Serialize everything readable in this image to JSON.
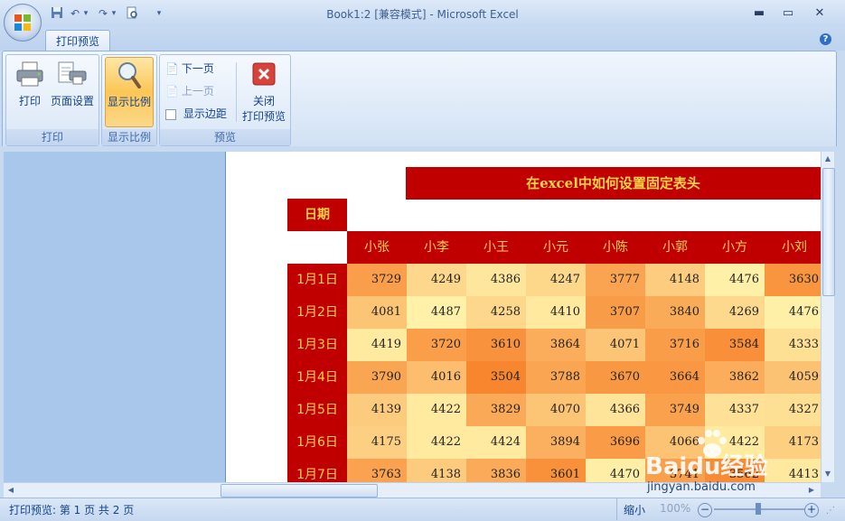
{
  "window": {
    "title": "Book1:2  [兼容模式] - Microsoft Excel",
    "minimize": "▬",
    "maximize": "▭",
    "close": "✕"
  },
  "tabs": [
    {
      "label": "打印预览",
      "active": true
    }
  ],
  "ribbon": {
    "groups": [
      {
        "label": "打印",
        "buttons": [
          {
            "label": "打印"
          },
          {
            "label": "页面设置"
          }
        ]
      },
      {
        "label": "显示比例",
        "buttons": [
          {
            "label": "显示比例",
            "active": true
          }
        ]
      },
      {
        "label": "预览",
        "small_buttons": [
          {
            "label": "下一页",
            "enabled": true
          },
          {
            "label": "上一页",
            "enabled": false
          },
          {
            "label": "显示边距",
            "checkbox": true,
            "checked": false
          }
        ],
        "close_button": {
          "line1": "关闭",
          "line2": "打印预览"
        }
      }
    ]
  },
  "sheet": {
    "title": "在excel中如何设置固定表头",
    "date_header": "日期",
    "names": [
      "小张",
      "小李",
      "小王",
      "小元",
      "小陈",
      "小郭",
      "小方",
      "小刘"
    ],
    "rows": [
      {
        "day": "1月1日",
        "values": [
          "3729",
          "4249",
          "4386",
          "4247",
          "3777",
          "4148",
          "4476",
          "3630"
        ]
      },
      {
        "day": "1月2日",
        "values": [
          "4081",
          "4487",
          "4258",
          "4410",
          "3707",
          "3840",
          "4269",
          "4476"
        ]
      },
      {
        "day": "1月3日",
        "values": [
          "4419",
          "3720",
          "3610",
          "3864",
          "4071",
          "3716",
          "3584",
          "4333"
        ]
      },
      {
        "day": "1月4日",
        "values": [
          "3790",
          "4016",
          "3504",
          "3788",
          "3670",
          "3664",
          "3862",
          "4059"
        ]
      },
      {
        "day": "1月5日",
        "values": [
          "4139",
          "4422",
          "3829",
          "4070",
          "4366",
          "3749",
          "4337",
          "4327"
        ]
      },
      {
        "day": "1月6日",
        "values": [
          "4175",
          "4422",
          "4424",
          "3894",
          "3696",
          "4066",
          "4422",
          "4173"
        ]
      },
      {
        "day": "1月7日",
        "values": [
          "3763",
          "4138",
          "3836",
          "3601",
          "4470",
          "3741",
          "3562",
          "4413"
        ]
      }
    ],
    "color_low": "#f8862f",
    "color_high": "#fff1a8"
  },
  "status": {
    "page_info": "打印预览: 第 1 页  共 2 页",
    "zoom_out": "缩小",
    "zoom_level": "100%"
  },
  "watermark": {
    "brand": "Baidu经验",
    "url": "jingyan.baidu.com"
  }
}
